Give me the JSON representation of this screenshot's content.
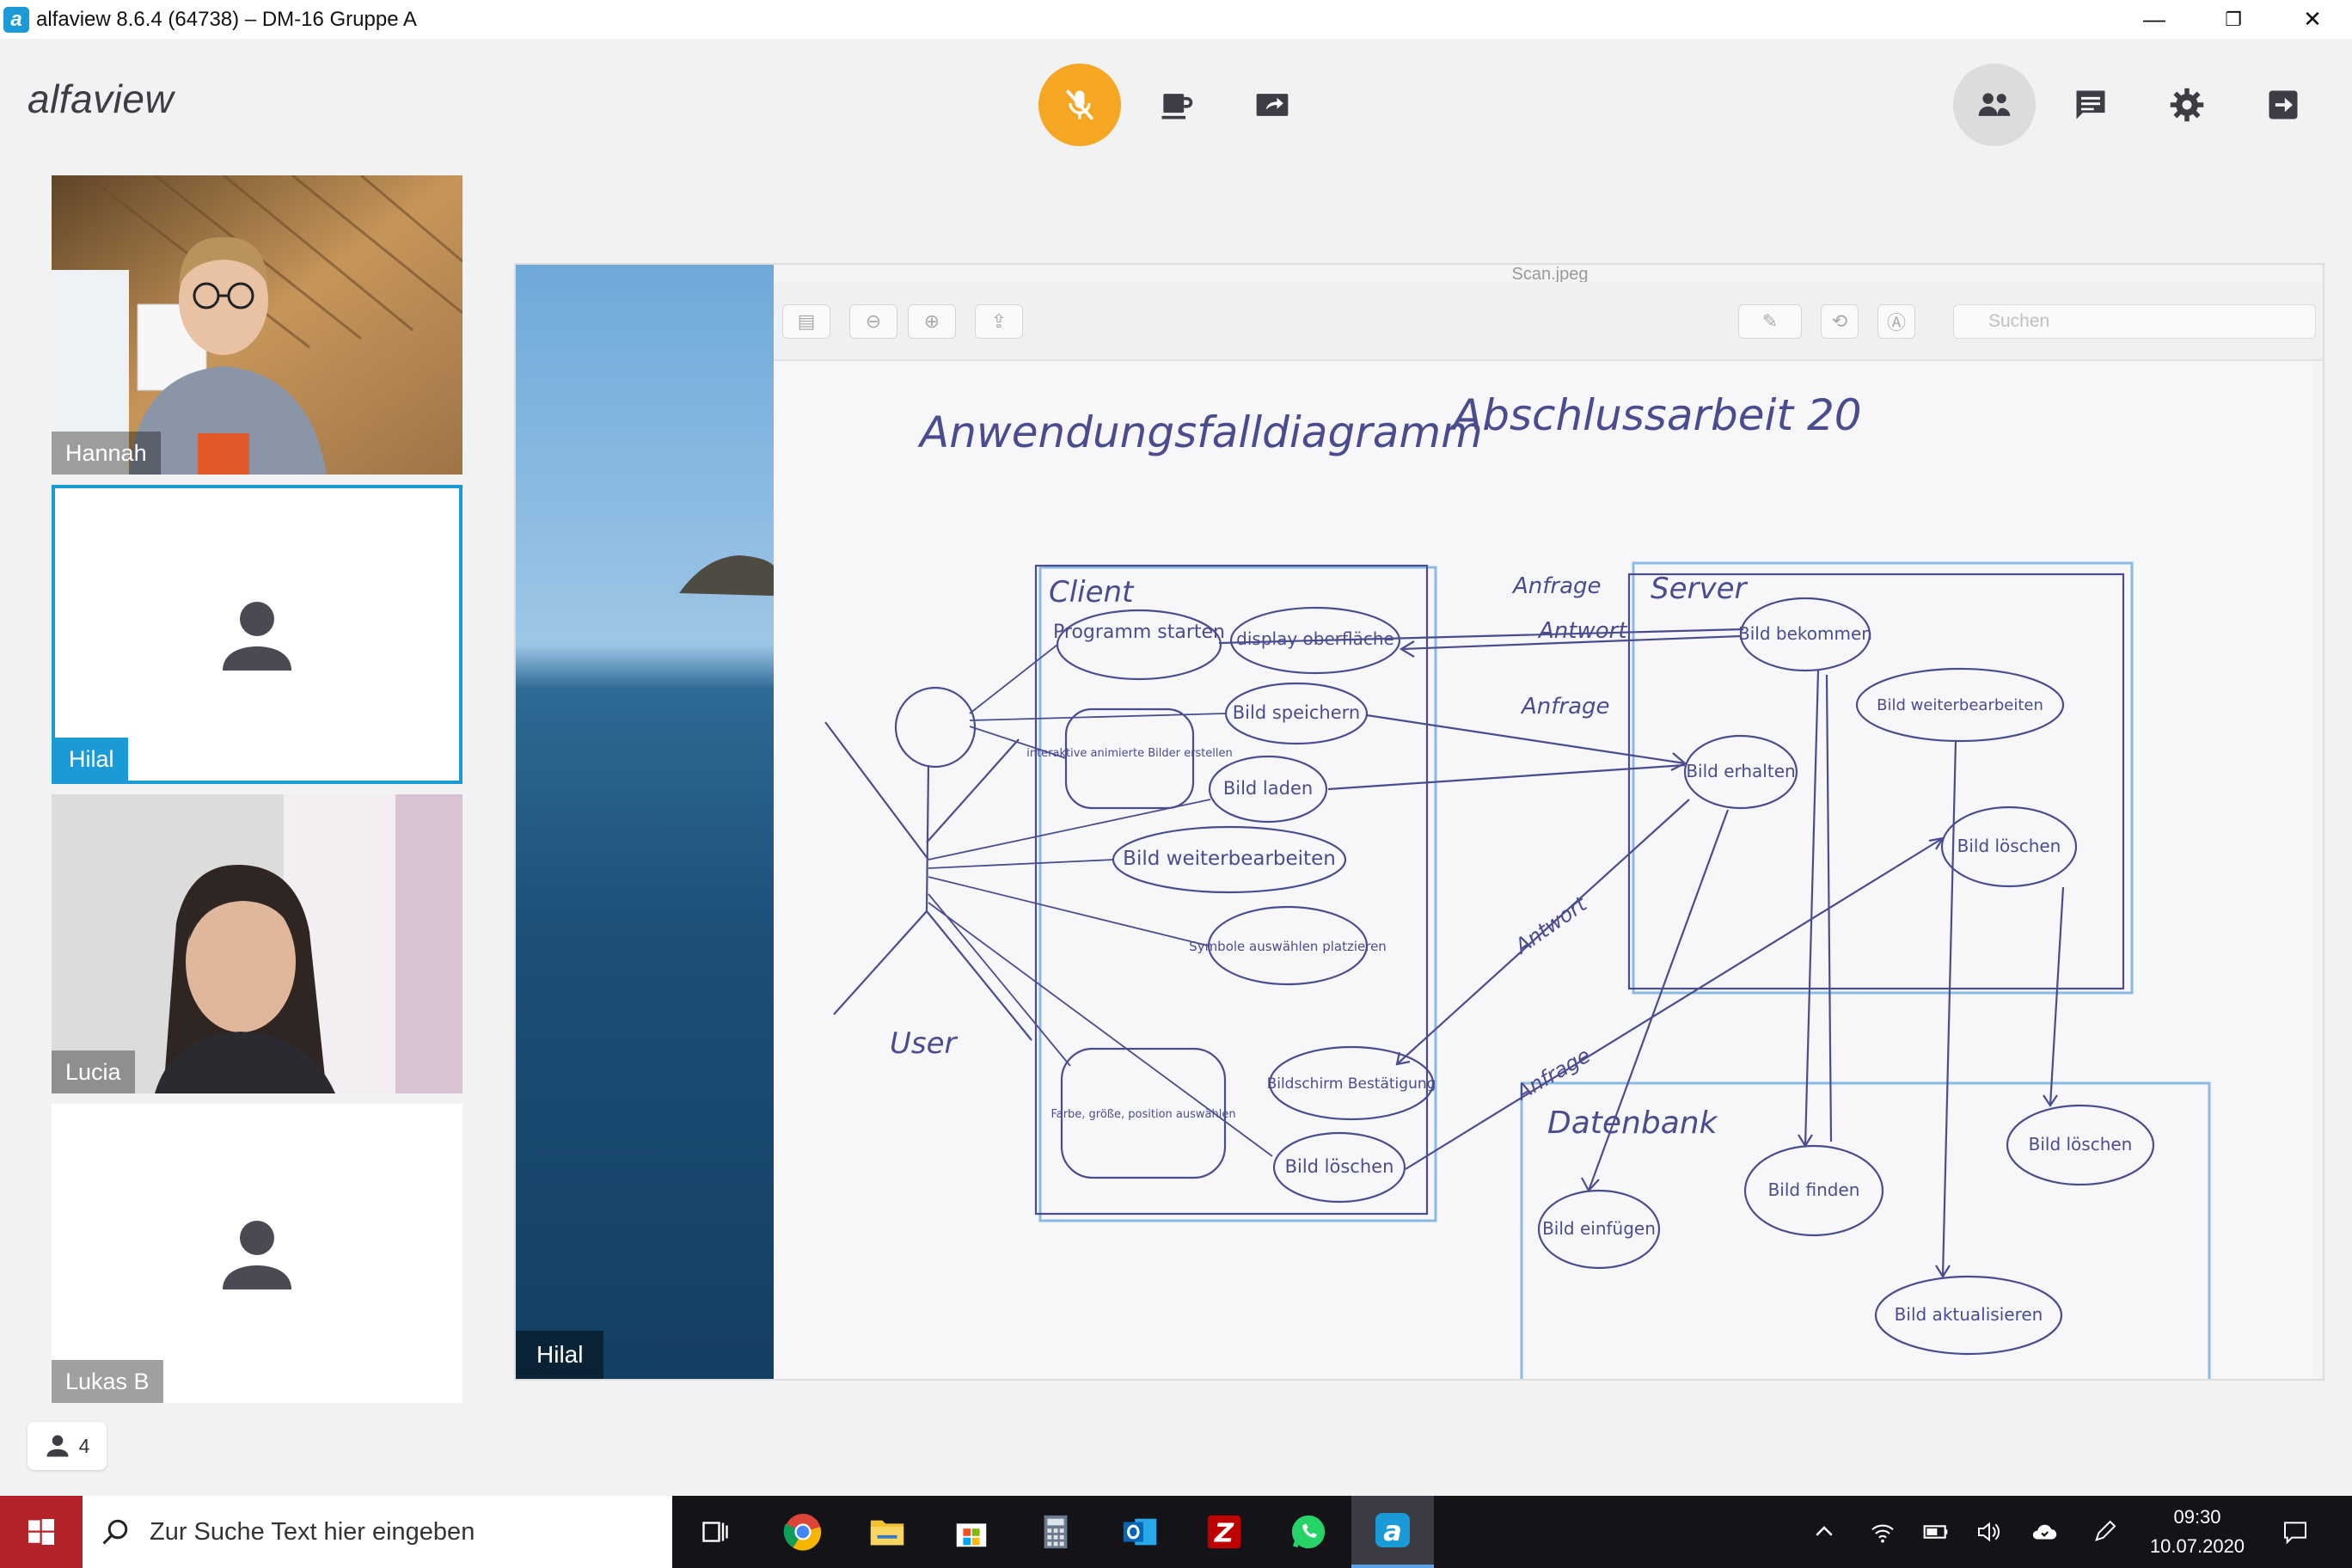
{
  "window": {
    "title": "alfaview 8.6.4 (64738) – DM-16 Gruppe A",
    "minimize": "—",
    "restore": "❐",
    "close": "✕"
  },
  "header": {
    "brand": "alfaview",
    "mic_state": "muted",
    "accent": "#f5a623",
    "brand_blue": "#1a9ad6"
  },
  "participants": [
    {
      "name": "Hannah",
      "video": "on"
    },
    {
      "name": "Hilal",
      "video": "off",
      "active": true
    },
    {
      "name": "Lucia",
      "video": "on"
    },
    {
      "name": "Lukas B",
      "video": "off"
    }
  ],
  "participant_count": "4",
  "screen_share": {
    "presenter": "Hilal",
    "file_title": "Scan.jpeg",
    "search_placeholder": "Suchen",
    "diagram": {
      "title": "Anwendungsfalldiagramm",
      "subtitle": "Abschlussarbeit 20",
      "actor": "User",
      "client_label": "Client",
      "server_label": "Server",
      "db_label": "Datenbank",
      "client_cases": [
        "Programm starten",
        "display oberfläche",
        "interaktive animierte Bilder erstellen",
        "Bild speichern",
        "Bild laden",
        "Bild weiterbearbeiten",
        "Symbole auswählen platzieren",
        "Farbe, größe, position auswählen",
        "Bildschirm Bestätigung",
        "Bild löschen"
      ],
      "server_cases": [
        "Bild bekommen",
        "Bild weiterbearbeiten",
        "Bild erhalten",
        "Bild löschen"
      ],
      "db_cases": [
        "Bild einfügen",
        "Bild finden",
        "Bild löschen",
        "Bild aktualisieren"
      ],
      "arrows": [
        "Anfrage",
        "Antwort",
        "Anfrage",
        "Antwort",
        "Anfrage"
      ]
    }
  },
  "taskbar": {
    "search_placeholder": "Zur Suche Text hier eingeben",
    "time": "09:30",
    "date": "10.07.2020"
  }
}
